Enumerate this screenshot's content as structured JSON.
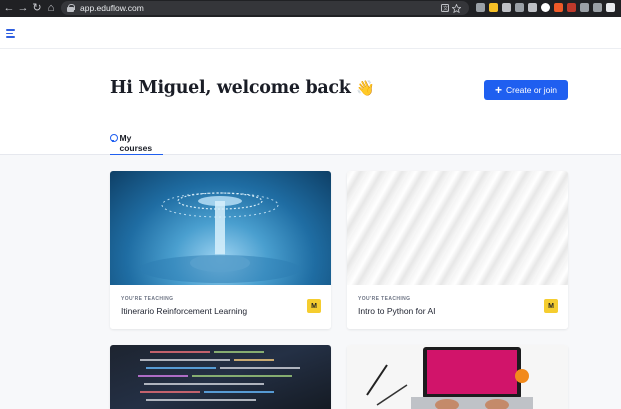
{
  "browser": {
    "url": "app.eduflow.com",
    "nav": [
      "←",
      "→",
      "↻",
      "⌂"
    ],
    "icons": [
      "translate-icon",
      "bookmark-star-icon"
    ],
    "extension_colors": [
      "#9aa0a6",
      "#f6c026",
      "#bfc1c6",
      "#9aa0a6",
      "#bfc1c6",
      "#ffffff",
      "#f05a28",
      "#c0392b",
      "#9aa0a6",
      "#9aa0a6",
      "#e8eaed"
    ]
  },
  "header": {
    "menu_icon": "menu-icon"
  },
  "hero": {
    "greeting": "Hi Miguel, welcome back",
    "wave_emoji": "👋",
    "create_button": {
      "icon": "+",
      "label": "Create or join"
    },
    "tab": {
      "icon": "lightbulb-icon",
      "label": "My courses"
    }
  },
  "courses": [
    {
      "eyebrow": "YOU'RE TEACHING",
      "title": "Itinerario Reinforcement Learning",
      "badge": "M",
      "image": "water-splash"
    },
    {
      "eyebrow": "YOU'RE TEACHING",
      "title": "Intro to Python for AI",
      "badge": "M",
      "image": "white-architecture"
    },
    {
      "eyebrow": "",
      "title": "",
      "badge": "",
      "image": "code-screen"
    },
    {
      "eyebrow": "",
      "title": "",
      "badge": "",
      "image": "laptop-desk"
    }
  ],
  "colors": {
    "accent": "#1f5ff0",
    "badge": "#f5cd2f",
    "chrome": "#202124"
  }
}
